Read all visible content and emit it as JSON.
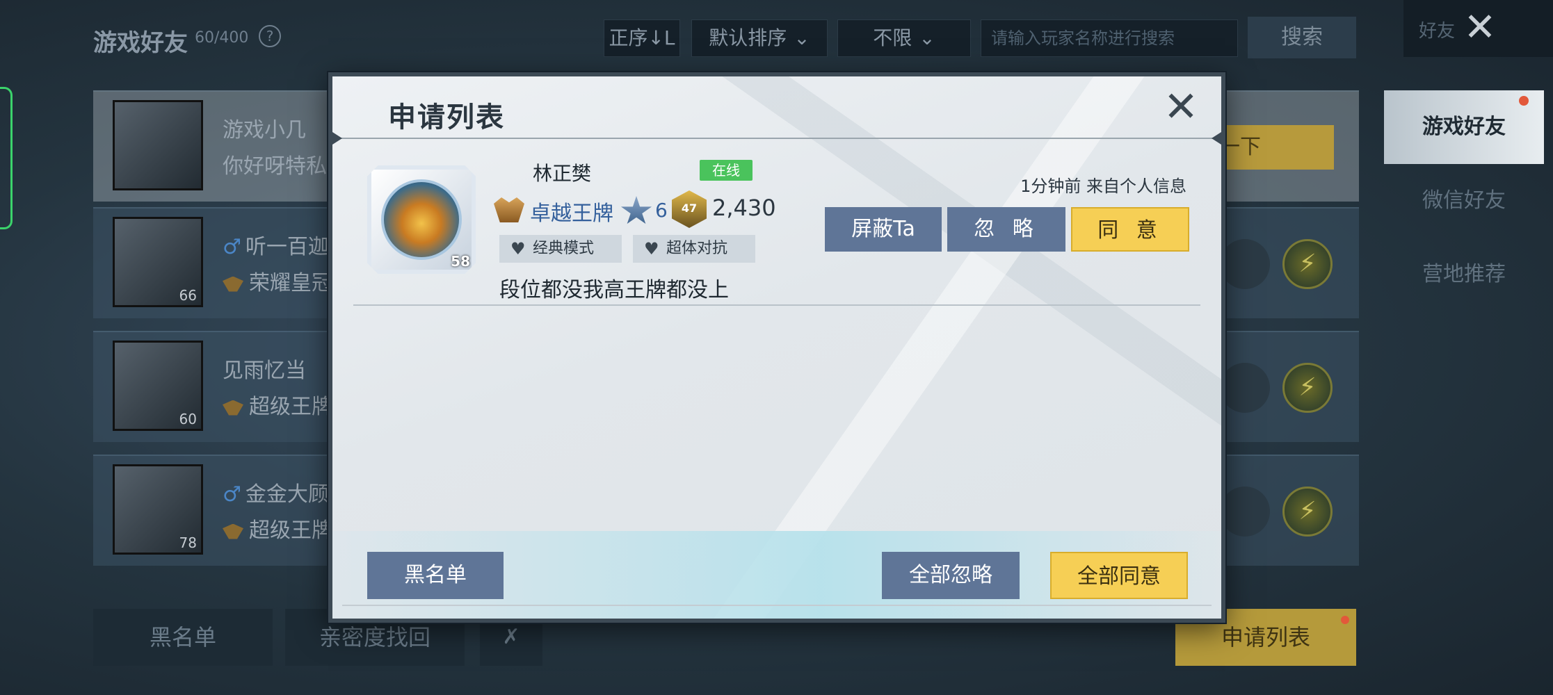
{
  "background": {
    "title": "游戏好友",
    "count": "60/400",
    "help_icon": "?",
    "sort_order": "正序↓L",
    "sort_mode": "默认排序",
    "filter": "不限",
    "search_placeholder": "请输入玩家名称进行搜索",
    "search_button": "搜索",
    "top_right_label": "好友",
    "friends": [
      {
        "name": "游戏小几",
        "sub": "你好呀特私",
        "level": ""
      },
      {
        "name": "听一百迦",
        "sub": "荣耀皇冠",
        "level": "66"
      },
      {
        "name": "见雨忆当",
        "sub": "超级王牌",
        "level": "60"
      },
      {
        "name": "金金大顾",
        "sub": "超级王牌",
        "level": "78"
      }
    ],
    "tease_button": "撩一下",
    "side_tabs": [
      "游戏好友",
      "微信好友",
      "营地推荐"
    ],
    "bottom_blacklist": "黑名单",
    "bottom_intimacy": "亲密度找回",
    "bottom_apply_list": "申请列表"
  },
  "modal": {
    "title": "申请列表",
    "request": {
      "name": "林正樊",
      "status": "在线",
      "avatar_level": "58",
      "rank": "卓越王牌",
      "stars": "6",
      "badge_level": "47",
      "points": "2,430",
      "tags": [
        "经典模式",
        "超体对抗"
      ],
      "message": "段位都没我高王牌都没上",
      "time_source": "1分钟前 来自个人信息",
      "block_button": "屏蔽Ta",
      "ignore_button": "忽 略",
      "agree_button": "同 意"
    },
    "footer": {
      "blacklist_button": "黑名单",
      "ignore_all_button": "全部忽略",
      "agree_all_button": "全部同意"
    }
  },
  "colors": {
    "online_green": "#4ac35c",
    "agree_yellow": "#f6cf55",
    "action_blue": "#5f7597",
    "rank_blue": "#34609c"
  }
}
